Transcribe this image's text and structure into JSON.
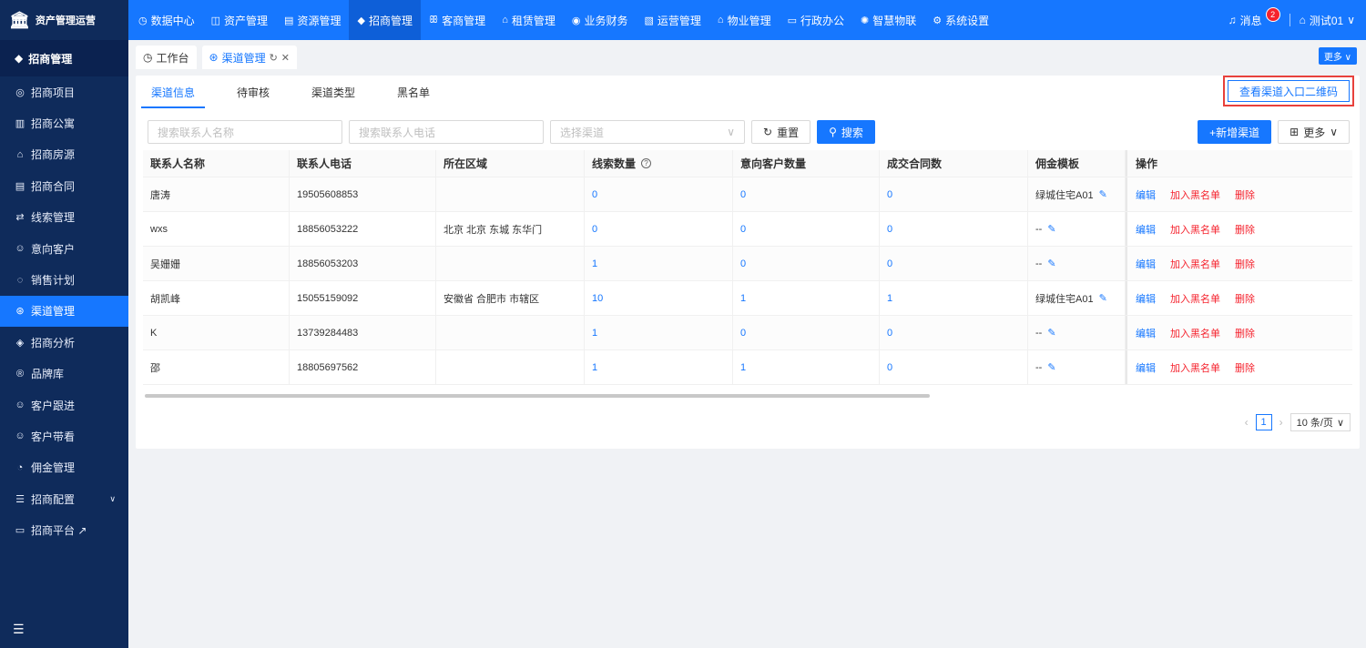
{
  "app": {
    "title": "资产管理运营"
  },
  "topnav": [
    {
      "icon": "◷",
      "label": "数据中心"
    },
    {
      "icon": "◫",
      "label": "资产管理"
    },
    {
      "icon": "▤",
      "label": "资源管理"
    },
    {
      "icon": "◆",
      "label": "招商管理",
      "active": true
    },
    {
      "icon": "ꕥ",
      "label": "客商管理"
    },
    {
      "icon": "⌂",
      "label": "租赁管理"
    },
    {
      "icon": "◉",
      "label": "业务财务"
    },
    {
      "icon": "▧",
      "label": "运营管理"
    },
    {
      "icon": "⌂",
      "label": "物业管理"
    },
    {
      "icon": "▭",
      "label": "行政办公"
    },
    {
      "icon": "✺",
      "label": "智慧物联"
    },
    {
      "icon": "⚙",
      "label": "系统设置"
    }
  ],
  "header_right": {
    "messages_label": "消息",
    "messages_count": "2",
    "user_label": "测试01"
  },
  "sidebar": {
    "section_title": "招商管理",
    "items": [
      {
        "icon": "◎",
        "label": "招商项目"
      },
      {
        "icon": "▥",
        "label": "招商公寓"
      },
      {
        "icon": "⌂",
        "label": "招商房源"
      },
      {
        "icon": "▤",
        "label": "招商合同"
      },
      {
        "icon": "⇄",
        "label": "线索管理"
      },
      {
        "icon": "☺",
        "label": "意向客户"
      },
      {
        "icon": "◌",
        "label": "销售计划"
      },
      {
        "icon": "⊛",
        "label": "渠道管理",
        "active": true
      },
      {
        "icon": "◈",
        "label": "招商分析"
      },
      {
        "icon": "®",
        "label": "品牌库"
      },
      {
        "icon": "☺",
        "label": "客户跟进"
      },
      {
        "icon": "☺",
        "label": "客户带看"
      },
      {
        "icon": "◔",
        "label": "佣金管理"
      },
      {
        "icon": "☰",
        "label": "招商配置",
        "caret": true
      },
      {
        "icon": "▭",
        "label": "招商平台 ↗"
      }
    ],
    "collapse_icon": "☰"
  },
  "pagetabs": [
    {
      "icon": "◷",
      "label": "工作台"
    },
    {
      "icon": "⊛",
      "label": "渠道管理",
      "active": true
    }
  ],
  "more_label": "更多 ∨",
  "subtabs": [
    "渠道信息",
    "待审核",
    "渠道类型",
    "黑名单"
  ],
  "qr_button_label": "查看渠道入口二维码",
  "filters": {
    "name_placeholder": "搜索联系人名称",
    "phone_placeholder": "搜索联系人电话",
    "channel_placeholder": "选择渠道",
    "reset_label": "重置",
    "search_label": "搜索",
    "add_label": "+新增渠道",
    "more_label": "更多"
  },
  "table": {
    "headers": [
      "联系人名称",
      "联系人电话",
      "所在区域",
      "线索数量",
      "意向客户数量",
      "成交合同数",
      "佣金模板",
      "操作"
    ],
    "actions": {
      "edit": "编辑",
      "blacklist": "加入黑名单",
      "delete": "删除"
    },
    "rows": [
      {
        "name": "唐涛",
        "phone": "19505608853",
        "area": "",
        "leads": "0",
        "intent": "0",
        "deals": "0",
        "template": "绿城住宅A01"
      },
      {
        "name": "wxs",
        "phone": "18856053222",
        "area": "北京 北京 东城 东华门",
        "leads": "0",
        "intent": "0",
        "deals": "0",
        "template": "--"
      },
      {
        "name": "吴姗姗",
        "phone": "18856053203",
        "area": "",
        "leads": "1",
        "intent": "0",
        "deals": "0",
        "template": "--"
      },
      {
        "name": "胡凯峰",
        "phone": "15055159092",
        "area": "安徽省 合肥市 市辖区",
        "leads": "10",
        "intent": "1",
        "deals": "1",
        "template": "绿城住宅A01"
      },
      {
        "name": "K",
        "phone": "13739284483",
        "area": "",
        "leads": "1",
        "intent": "0",
        "deals": "0",
        "template": "--"
      },
      {
        "name": "邵",
        "phone": "18805697562",
        "area": "",
        "leads": "1",
        "intent": "1",
        "deals": "0",
        "template": "--"
      }
    ]
  },
  "pagination": {
    "current": "1",
    "page_size": "10 条/页"
  }
}
